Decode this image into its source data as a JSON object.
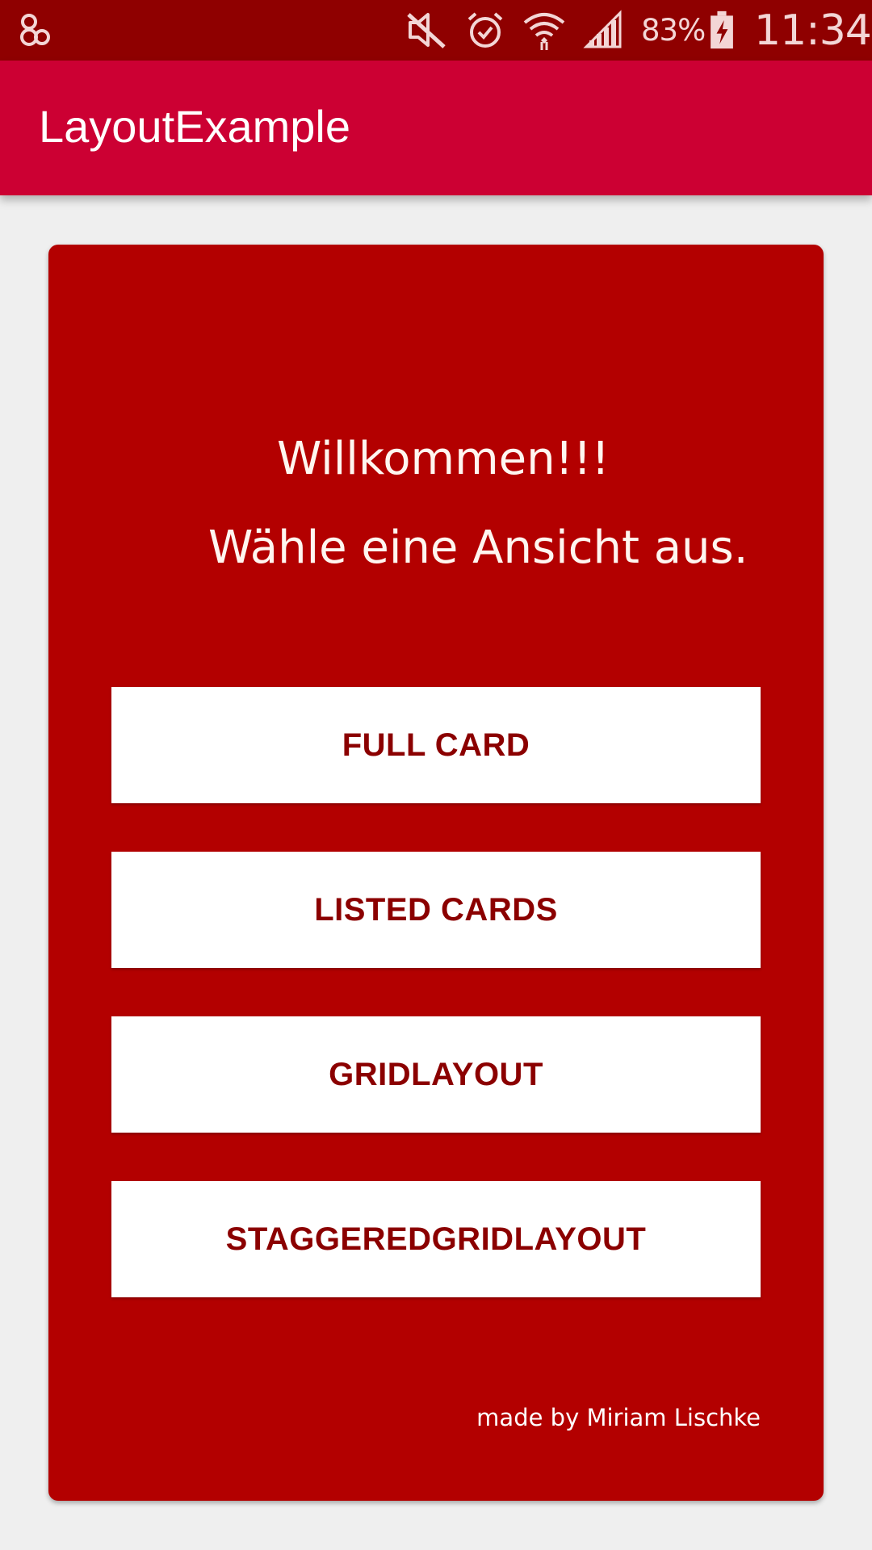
{
  "status_bar": {
    "battery_percent": "83%",
    "time": "11:34",
    "icons": [
      "app-notification-icon",
      "mute-icon",
      "alarm-icon",
      "wifi-icon",
      "signal-icon",
      "battery-charging-icon"
    ]
  },
  "app_bar": {
    "title": "LayoutExample"
  },
  "card": {
    "welcome_line1": "Willkommen!!!",
    "welcome_line2": "Wähle eine Ansicht aus.",
    "buttons": [
      {
        "label": "FULL CARD"
      },
      {
        "label": "LISTED CARDS"
      },
      {
        "label": "GRIDLAYOUT"
      },
      {
        "label": "STAGGEREDGRIDLAYOUT"
      }
    ],
    "credit": "made by Miriam Lischke"
  },
  "colors": {
    "status_bar": "#8f0000",
    "app_bar": "#cc0033",
    "card": "#b30000",
    "button_text": "#8b0000",
    "background": "#efefef"
  }
}
